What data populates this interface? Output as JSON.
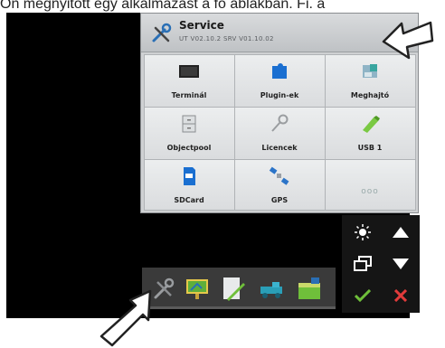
{
  "caption": "Ön megnyitott egy alkalmazást a fő ablakban. Fi. a",
  "window": {
    "title": "Service",
    "subtitle": "UT V02.10.2  SRV V01.10.02"
  },
  "tiles": [
    {
      "label": "Terminál",
      "icon": "terminal-icon"
    },
    {
      "label": "Plugin-ek",
      "icon": "puzzle-icon"
    },
    {
      "label": "Meghajtó",
      "icon": "drive-icon"
    },
    {
      "label": "Objectpool",
      "icon": "cabinet-icon"
    },
    {
      "label": "Licencek",
      "icon": "key-icon"
    },
    {
      "label": "USB 1",
      "icon": "usb-icon"
    },
    {
      "label": "SDCard",
      "icon": "sdcard-icon"
    },
    {
      "label": "GPS",
      "icon": "satellite-icon"
    },
    {
      "label": "",
      "icon": "more-icon",
      "more": "ooo"
    }
  ],
  "side_buttons": [
    "brightness-icon",
    "arrow-up-icon",
    "window-switch-icon",
    "arrow-down-icon",
    "check-icon",
    "close-icon"
  ],
  "bottom_bar": [
    "wrench-icon",
    "app-map-icon",
    "app-notes-icon",
    "app-tractor-icon",
    "app-field-icon"
  ],
  "colors": {
    "accent_green": "#6fbf3a",
    "cancel_red": "#e23b3b",
    "arrow_fill": "#ffffff"
  }
}
